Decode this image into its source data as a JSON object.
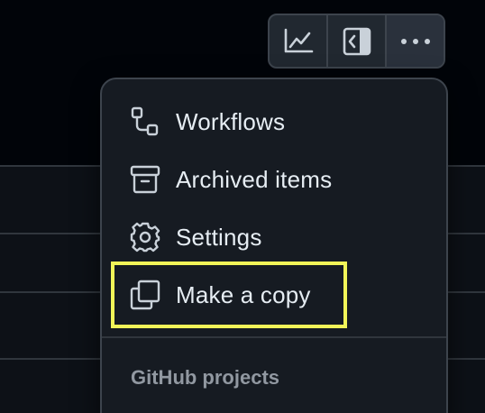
{
  "toolbar": {
    "buttons": [
      {
        "icon": "graph-icon",
        "tooltip": ""
      },
      {
        "icon": "sidebar-panel-icon",
        "tooltip": ""
      },
      {
        "icon": "kebab-horizontal-icon",
        "tooltip": ""
      }
    ]
  },
  "menu": {
    "items": [
      {
        "label": "Workflows",
        "icon": "workflow-icon"
      },
      {
        "label": "Archived items",
        "icon": "archive-icon"
      },
      {
        "label": "Settings",
        "icon": "gear-icon"
      },
      {
        "label": "Make a copy",
        "icon": "copy-icon"
      }
    ],
    "section_header": "GitHub projects"
  },
  "colors": {
    "background": "#010409",
    "menu_bg": "#161b22",
    "border": "#3d444d",
    "text": "#e6edf3",
    "muted_text": "#9198a1",
    "highlight": "#f1f558"
  }
}
